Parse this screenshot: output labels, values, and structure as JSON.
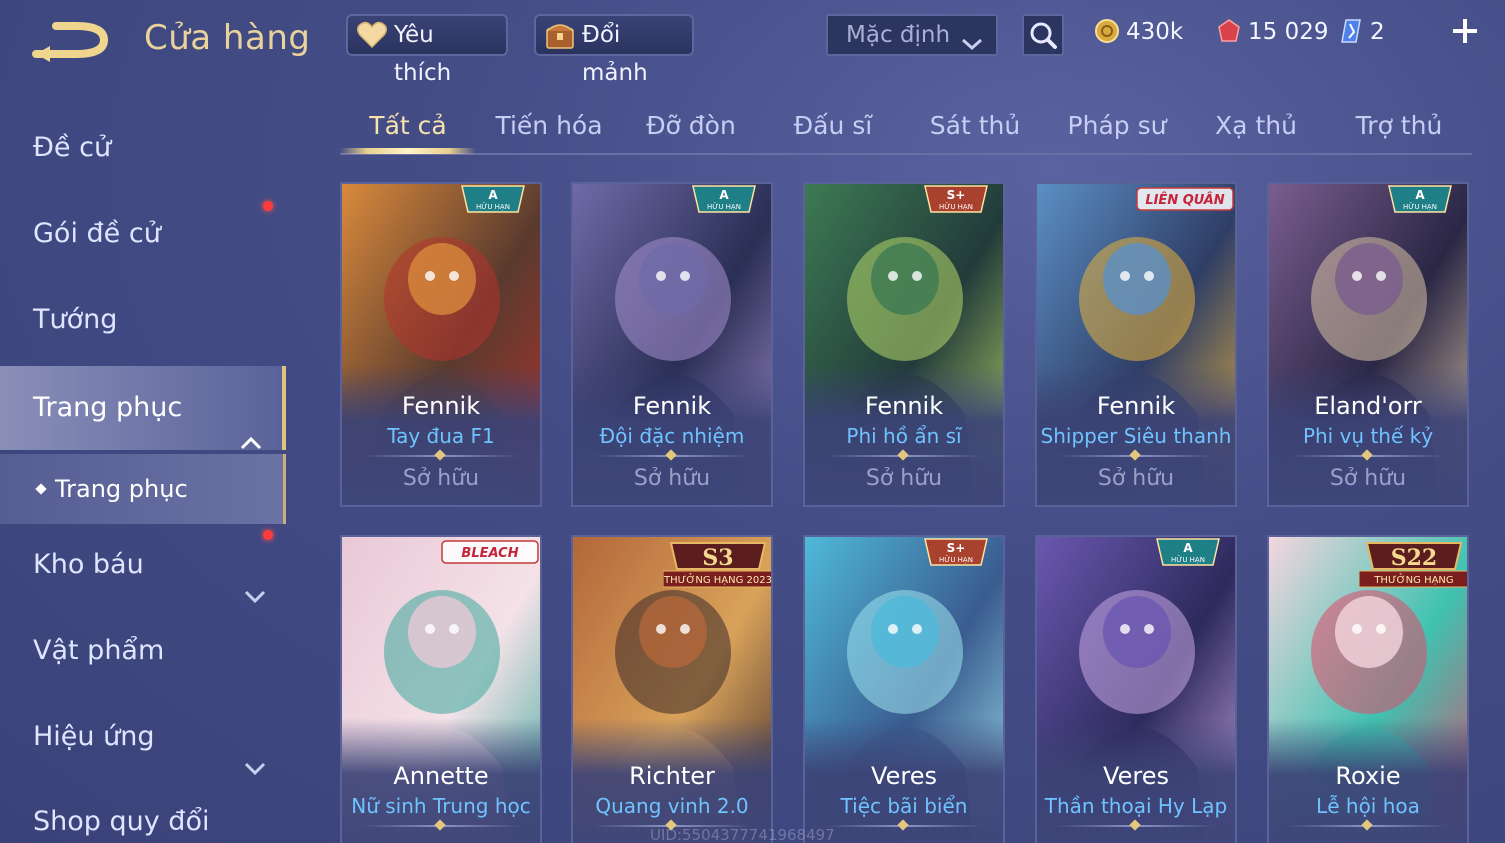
{
  "header": {
    "title": "Cửa hàng",
    "favorite_label": "Yêu thích",
    "shard_label": "Đổi mảnh",
    "sort_value": "Mặc định",
    "currencies": [
      {
        "icon": "gold-coin-icon",
        "value": "430k"
      },
      {
        "icon": "red-voucher-icon",
        "value": "15 029"
      },
      {
        "icon": "blue-gem-icon",
        "value": "2"
      }
    ]
  },
  "sidebar": {
    "items": [
      {
        "label": "Đề cử"
      },
      {
        "label": "Gói đề cử"
      },
      {
        "label": "Tướng"
      },
      {
        "label": "Trang phục"
      },
      {
        "label": "Trang phục"
      },
      {
        "label": "Kho báu"
      },
      {
        "label": "Vật phẩm"
      },
      {
        "label": "Hiệu ứng"
      },
      {
        "label": "Shop quy đổi"
      }
    ]
  },
  "tabs": [
    "Tất cả",
    "Tiến hóa",
    "Đỡ đòn",
    "Đấu sĩ",
    "Sát thủ",
    "Pháp sư",
    "Xạ thủ",
    "Trợ thủ"
  ],
  "cards": [
    {
      "hero": "Fennik",
      "skin": "Tay đua F1",
      "owned": "Sở hữu",
      "badge": "A",
      "badge_sub": "HỮU HẠN",
      "colors": [
        "#d98a3c",
        "#b3332e",
        "#5a3a2e"
      ]
    },
    {
      "hero": "Fennik",
      "skin": "Đội đặc nhiệm",
      "owned": "Sở hữu",
      "badge": "A",
      "badge_sub": "HỮU HẠN",
      "colors": [
        "#6f6aa8",
        "#a58fd0",
        "#2a2f55"
      ]
    },
    {
      "hero": "Fennik",
      "skin": "Phi hồ ẩn sĩ",
      "owned": "Sở hữu",
      "badge": "S+",
      "badge_sub": "HỮU HẠN",
      "colors": [
        "#3d7a53",
        "#b7d86a",
        "#223b3a"
      ]
    },
    {
      "hero": "Fennik",
      "skin": "Shipper Siêu thanh",
      "owned": "Sở hữu",
      "badge": "LIÊN QUÂN",
      "badge_sub": "",
      "colors": [
        "#5b8fc5",
        "#e6b33d",
        "#2f3e66"
      ]
    },
    {
      "hero": "Eland'orr",
      "skin": "Phi vụ thế kỷ",
      "owned": "Sở hữu",
      "badge": "A",
      "badge_sub": "HỮU HẠN",
      "colors": [
        "#7a5d8f",
        "#d8c2a5",
        "#2a2745"
      ]
    },
    {
      "hero": "Annette",
      "skin": "Nữ sinh Trung học",
      "owned": "",
      "badge": "BLEACH",
      "badge_sub": "",
      "colors": [
        "#e9c8d6",
        "#3aa89a",
        "#f4e2e8"
      ]
    },
    {
      "hero": "Richter",
      "skin": "Quang vinh 2.0",
      "owned": "",
      "badge": "S3",
      "badge_sub": "THƯỞNG HẠNG 2023",
      "colors": [
        "#b3673a",
        "#3b2a2a",
        "#d9a25a"
      ]
    },
    {
      "hero": "Veres",
      "skin": "Tiệc bãi biển",
      "owned": "",
      "badge": "S+",
      "badge_sub": "HỮU HẠN",
      "colors": [
        "#4fb9d9",
        "#9fe3f0",
        "#3a5c8f"
      ]
    },
    {
      "hero": "Veres",
      "skin": "Thần thoại Hy Lạp",
      "owned": "",
      "badge": "A",
      "badge_sub": "HỮU HẠN",
      "colors": [
        "#6a58b0",
        "#c9a7e6",
        "#2d2a5c"
      ]
    },
    {
      "hero": "Roxie",
      "skin": "Lễ hội hoa",
      "owned": "",
      "badge": "S22",
      "badge_sub": "THƯỞNG HẠNG",
      "colors": [
        "#f4d6df",
        "#e04a6a",
        "#3fc2b0"
      ]
    }
  ],
  "watermark": "UID:5504377741968497",
  "colors": {
    "accent_gold": "#e9d39a",
    "skin_name_blue": "#6fc3ff",
    "notify_red": "#ff3b3b"
  }
}
